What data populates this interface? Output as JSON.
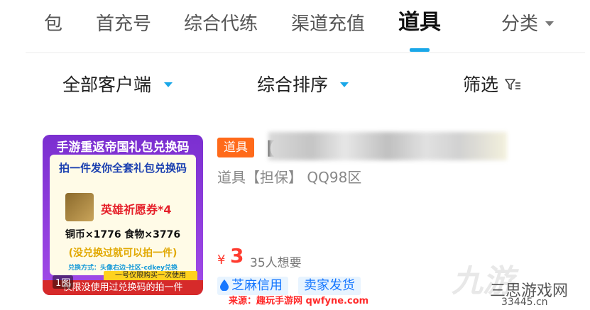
{
  "tabs": {
    "items": [
      "包",
      "首充号",
      "综合代练",
      "渠道充值",
      "道具",
      "分类"
    ],
    "active": "道具"
  },
  "filters": {
    "client": "全部客户端",
    "sort": "综合排序",
    "filter": "筛选"
  },
  "listing": {
    "thumbnail": {
      "title": "手游重返帝国礼包兑换码",
      "line1": "拍一件发你全套礼包兑换码",
      "line2": "英雄祈愿券*4",
      "line3": "铜币×1776  食物×3776",
      "line4": "(没兑换过就可以拍一件)",
      "line5": "兑换方式：头像右边-社区-cdkey兑换",
      "yellow_strip": "一号仅限购买一次使用",
      "bottom_banner": "仅限没使用过兑换码的拍一件",
      "image_count": "1图"
    },
    "tag": "道具",
    "title_prefix": "【",
    "subtitle": "道具【担保】 QQ98区",
    "price_symbol": "¥",
    "price": "3",
    "wants": "35人想要",
    "badges": {
      "credit": "芝麻信用",
      "shipping": "卖家发货"
    }
  },
  "watermark": {
    "logo": "九游",
    "site_name": "三思游戏网",
    "site_url": "33445.cn",
    "source": "来源：趣玩手游网 qwfyne.com"
  },
  "colors": {
    "accent": "#1aa7e8",
    "price": "#ff3b2f",
    "tag": "#ff6a1a",
    "badge_text": "#1677ff",
    "badge_bg": "#e8f4ff"
  }
}
